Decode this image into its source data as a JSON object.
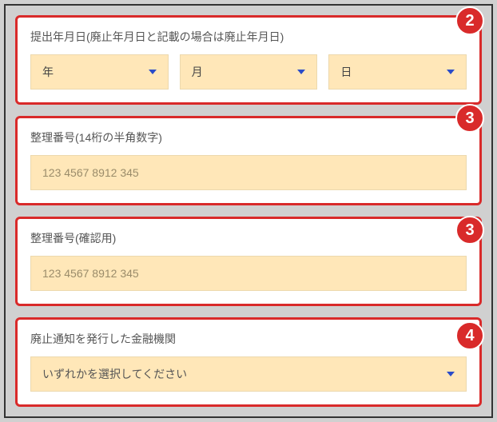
{
  "sections": {
    "submission_date": {
      "label": "提出年月日(廃止年月日と記載の場合は廃止年月日)",
      "year": "年",
      "month": "月",
      "day": "日",
      "badge": "2"
    },
    "ref_number": {
      "label": "整理番号(14桁の半角数字)",
      "placeholder": "123 4567 8912 345",
      "badge": "3"
    },
    "ref_number_confirm": {
      "label": "整理番号(確認用)",
      "placeholder": "123 4567 8912 345",
      "badge": "3"
    },
    "institution": {
      "label": "廃止通知を発行した金融機関",
      "selected": "いずれかを選択してください",
      "badge": "4"
    }
  }
}
